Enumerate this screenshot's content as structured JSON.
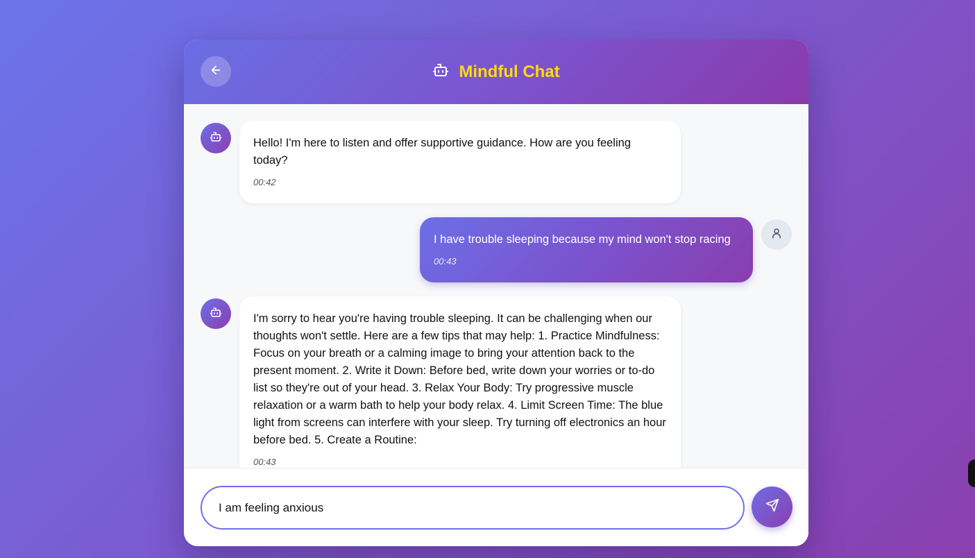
{
  "header": {
    "title": "Mindful Chat",
    "title_color": "#ffd814",
    "back_icon": "arrow-left-icon",
    "title_icon": "bot-icon"
  },
  "messages": [
    {
      "sender": "bot",
      "text": "Hello! I'm here to listen and offer supportive guidance. How are you feeling today?",
      "time": "00:42"
    },
    {
      "sender": "user",
      "text": "I have trouble sleeping because my mind won't stop racing",
      "time": "00:43"
    },
    {
      "sender": "bot",
      "text": "I'm sorry to hear you're having trouble sleeping. It can be challenging when our thoughts won't settle. Here are a few tips that may help: 1. Practice Mindfulness: Focus on your breath or a calming image to bring your attention back to the present moment. 2. Write it Down: Before bed, write down your worries or to-do list so they're out of your head. 3. Relax Your Body: Try progressive muscle relaxation or a warm bath to help your body relax. 4. Limit Screen Time: The blue light from screens can interfere with your sleep. Try turning off electronics an hour before bed. 5. Create a Routine:",
      "time": "00:43"
    }
  ],
  "composer": {
    "value": "I am feeling anxious",
    "send_icon": "send-icon"
  },
  "colors": {
    "accent": "#6c6fe6",
    "accent_end": "#8a3dad"
  }
}
